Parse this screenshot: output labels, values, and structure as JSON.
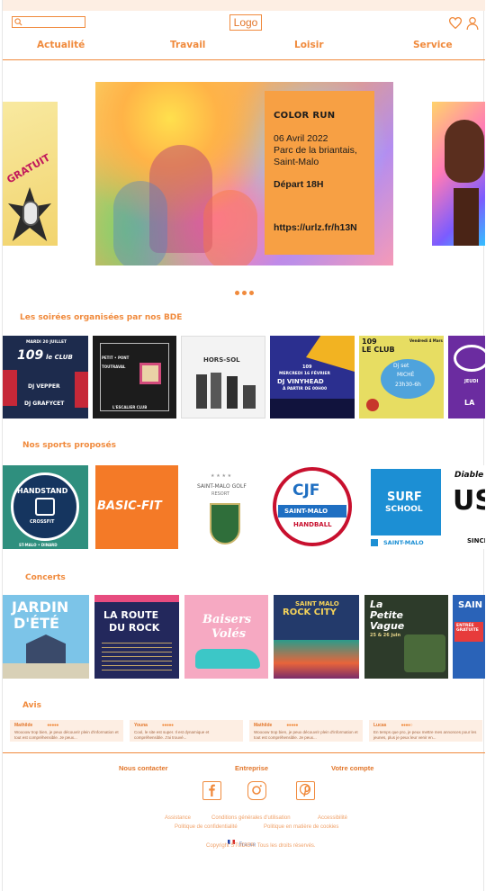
{
  "header": {
    "search_placeholder": "",
    "logo": "Logo",
    "nav": [
      "Actualité",
      "Travail",
      "Loisir",
      "Service"
    ]
  },
  "hero": {
    "title": "COLOR RUN",
    "date": "06 Avril 2022",
    "place": "Parc de la briantais, Saint-Malo",
    "depart": "Départ 18H",
    "url": "https://urlz.fr/h13N",
    "side_left_label": "GRATUIT"
  },
  "sections": {
    "soirees": "Les soirées organisées par nos BDE",
    "sports": "Nos sports proposés",
    "concerts": "Concerts",
    "avis": "Avis"
  },
  "soirees": [
    {
      "line1": "MARDI 20 JUILLET",
      "line2": "109",
      "line3": "le CLUB",
      "line4": "DJ VEPPER",
      "line5": "DJ GRAFYCET"
    },
    {
      "line1": "PETIT • PONT",
      "line2": "TOUTRAVAL",
      "line3": "L'ESCALIER CLUB"
    },
    {
      "line1": "HORS-SOL"
    },
    {
      "line1": "109",
      "line2": "MERCREDI 16 FÉVRIER",
      "line3": "DJ VINYHEAD",
      "line4": "À PARTIR DE 00H00"
    },
    {
      "line1": "109",
      "line2": "LE CLUB",
      "line3": "Vendredi 4 Mars",
      "line4": "Dj set",
      "line5": "MICHÉ",
      "line6": "23h30-6h"
    },
    {
      "line1": "JEUDI",
      "line2": "LA"
    }
  ],
  "sports": [
    {
      "name": "HANDSTAND",
      "sub": "CROSSFIT",
      "foot": "ST-MALO • DINARD"
    },
    {
      "name": "BASIC-FIT"
    },
    {
      "name": "SAINT-MALO GOLF",
      "sub": "RESORT"
    },
    {
      "name": "CJF",
      "sub": "SAINT-MALO",
      "foot": "HANDBALL"
    },
    {
      "name": "SURF",
      "sub": "SCHOOL",
      "foot": "SAINT-MALO"
    },
    {
      "name": "Diable",
      "sub": "US",
      "foot": "SINCE"
    }
  ],
  "concerts": [
    {
      "line1": "JARDIN",
      "line2": "D'ÉTÉ"
    },
    {
      "line1": "LA ROUTE",
      "line2": "DU ROCK"
    },
    {
      "line1": "Baisers",
      "line2": "Volés"
    },
    {
      "line1": "SAINT MALO",
      "line2": "ROCK CITY"
    },
    {
      "line1": "La",
      "line2": "Petite",
      "line3": "Vague",
      "line4": "25 & 26 juin"
    },
    {
      "line1": "SAIN",
      "line2": "ENTRÉE GRATUITE"
    }
  ],
  "reviews": [
    {
      "name": "Mathilde",
      "stars": "●●●●●",
      "text": "Woooow trop bien, je peux découvrir plein d'information et tout est compréhensible. Je peux..."
    },
    {
      "name": "Youna",
      "stars": "●●●●●",
      "text": "Cool, le site est super. Il est dynamique et compréhensible. J'ai trouvé..."
    },
    {
      "name": "Mathilde",
      "stars": "●●●●●",
      "text": "Woooow trop bien, je peux découvrir plein d'information et tout est compréhensible. Je peux..."
    },
    {
      "name": "Lucas",
      "stars": "●●●●○",
      "text": "En temps que pro, je peux mettre mes annonces pour les jeunes, plus je peux leur venir en..."
    }
  ],
  "footer": {
    "headings": [
      "Nous contacter",
      "Entreprise",
      "Votre compte"
    ],
    "links_row1": [
      "Assistance",
      "Conditions générales d'utilisation",
      "Accessibilité"
    ],
    "links_row2": [
      "Politique de confidentialité",
      "Politique en matière de cookies"
    ],
    "country": "France",
    "copyright": "Copyright STUDIER. Tous les droits réservés."
  },
  "colors": {
    "accent": "#f08a3c",
    "hero_box": "#f7a044"
  }
}
